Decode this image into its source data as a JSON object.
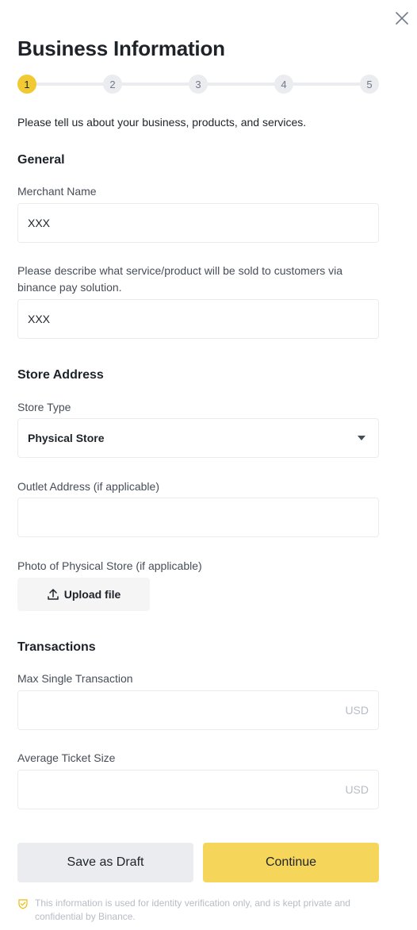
{
  "header": {
    "title": "Business Information"
  },
  "stepper": {
    "steps": [
      "1",
      "2",
      "3",
      "4",
      "5"
    ],
    "current": 1
  },
  "intro": "Please tell us about your business, products, and services.",
  "general": {
    "section_title": "General",
    "merchant_name_label": "Merchant Name",
    "merchant_name_value": "XXX",
    "description_label": "Please describe what service/product will be sold to customers via binance pay solution.",
    "description_value": "XXX"
  },
  "store_address": {
    "section_title": "Store Address",
    "store_type_label": "Store Type",
    "store_type_value": "Physical Store",
    "outlet_address_label": "Outlet Address (if applicable)",
    "outlet_address_value": "",
    "photo_label": "Photo of Physical Store (if applicable)",
    "upload_label": "Upload file"
  },
  "transactions": {
    "section_title": "Transactions",
    "max_single_label": "Max Single Transaction",
    "max_single_suffix": "USD",
    "avg_ticket_label": "Average Ticket Size",
    "avg_ticket_suffix": "USD"
  },
  "actions": {
    "draft_label": "Save as Draft",
    "continue_label": "Continue"
  },
  "footer_note": "This information is used for identity verification only, and is kept private and confidential by Binance.",
  "colors": {
    "accent": "#F0C933",
    "continue_bg": "#F5D65A",
    "secondary_bg": "#EAECEF",
    "text": "#1E2329",
    "muted": "#B7BDC6"
  }
}
